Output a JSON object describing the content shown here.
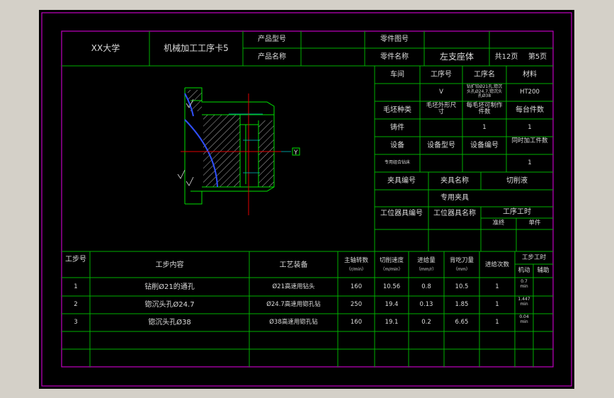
{
  "header": {
    "school": "XX大学",
    "card_title": "机械加工工序卡5",
    "product_model_label": "产品型号",
    "product_name_label": "产品名称",
    "part_drawing_no_label": "零件图号",
    "part_name_label": "零件名称",
    "part_name": "左支座体",
    "pages": "共12页",
    "page_no": "第5页"
  },
  "info": {
    "workshop_label": "车间",
    "op_no_label": "工序号",
    "op_name_label": "工序名",
    "material_label": "材料",
    "op_no": "V",
    "op_name": "钻扩铰Ø21孔,锪沉头孔Ø24.7,锪沉头孔Ø38",
    "material": "HT200",
    "blank_type_label": "毛坯种类",
    "blank_size_label": "毛坯外形尺寸",
    "blank_count_label": "每毛坯可制作件数",
    "per_unit_label": "每台件数",
    "blank_type": "铸件",
    "blank_count": "1",
    "per_unit": "1",
    "equipment_label": "设备",
    "equipment_model_label": "设备型号",
    "equipment_no_label": "设备编号",
    "simultaneous_label": "同时加工件数",
    "equipment": "专用组合钻床",
    "simultaneous": "1",
    "fixture_no_label": "夹具编号",
    "fixture_name_label": "夹具名称",
    "coolant_label": "切削液",
    "fixture_name": "专用夹具",
    "station_no_label": "工位器具编号",
    "station_name_label": "工位器具名称",
    "op_time_label": "工序工时",
    "prep_label": "准终",
    "unit_label": "单件"
  },
  "drawing": {
    "y_tag": "Y"
  },
  "table": {
    "headers": {
      "step_no": "工步号",
      "content": "工步内容",
      "equipment": "工艺装备",
      "spindle": "主轴转数",
      "spindle_unit": "（r/min）",
      "speed": "切削速度",
      "speed_unit": "（m/min）",
      "feed": "进给量",
      "feed_unit": "（mm/r）",
      "depth": "背吃刀量",
      "depth_unit": "（mm）",
      "passes": "进给次数",
      "time": "工步工时",
      "machine": "机动",
      "aux": "辅助"
    },
    "rows": [
      {
        "no": "1",
        "content": "钻削Ø21的通孔",
        "equipment": "Ø21高速用钻头",
        "spindle": "160",
        "speed": "10.56",
        "feed": "0.8",
        "depth": "10.5",
        "passes": "1",
        "machine": "0.7 min"
      },
      {
        "no": "2",
        "content": "锪沉头孔Ø24.7",
        "equipment": "Ø24.7高速用锪孔钻",
        "spindle": "250",
        "speed": "19.4",
        "feed": "0.13",
        "depth": "1.85",
        "passes": "1",
        "machine": "1.447 min"
      },
      {
        "no": "3",
        "content": "锪沉头孔Ø38",
        "equipment": "Ø38高速用锪孔钻",
        "spindle": "160",
        "speed": "19.1",
        "feed": "0.2",
        "depth": "6.65",
        "passes": "1",
        "machine": "0.04 min"
      }
    ]
  },
  "colors": {
    "background": "#000000",
    "frame": "#c000c0",
    "grid": "#00b000",
    "text": "#dcdcdc",
    "axis": "#e00000",
    "dim": "#00c0c0",
    "outline": "#00e000"
  }
}
